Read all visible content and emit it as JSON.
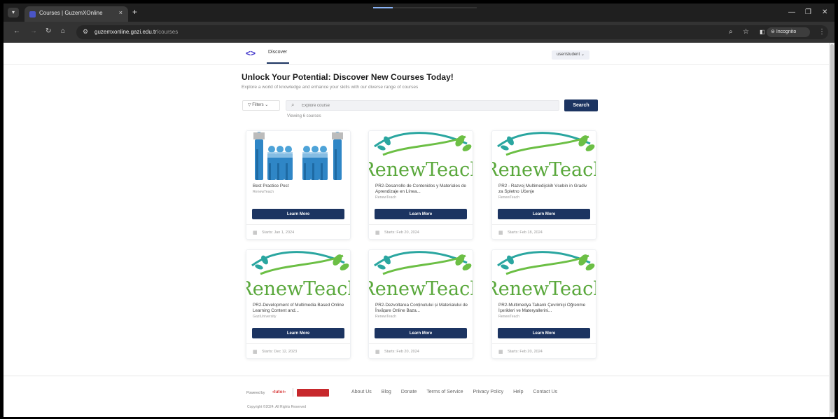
{
  "browser": {
    "tab_title": "Courses | GuzemXOnline",
    "close_tab": "×",
    "new_tab": "+",
    "url_host": "guzemxonline.gazi.edu.tr",
    "url_path": "/courses",
    "incognito_label": "Incognito"
  },
  "nav": {
    "discover": "Discover",
    "user_menu": "user/student ⌄"
  },
  "hero": {
    "title": "Unlock Your Potential: Discover New Courses Today!",
    "subtitle": "Explore a world of knowledge and enhance your skills with our diverse range of courses"
  },
  "search": {
    "filters_label": "Filters",
    "placeholder": "Explore course",
    "button": "Search",
    "viewing": "Viewing 6 courses"
  },
  "courses": [
    {
      "title": "Best Practice Post",
      "author": "RenewTeach",
      "button": "Learn More",
      "start": "Starts: Jan 1, 2024",
      "image": "people-icon"
    },
    {
      "title": "PR2-Desarrollo de Contenidos y Materiales de Aprendizaje en Línea...",
      "author": "RenewTeach",
      "button": "Learn More",
      "start": "Starts: Feb 20, 2024",
      "image": "renewteach-logo"
    },
    {
      "title": "PR2 - Razvoj Multimedijskih Vsebin in Gradiv za Spletno Učenje",
      "author": "RenewTeach",
      "button": "Learn More",
      "start": "Starts: Feb 18, 2024",
      "image": "renewteach-logo"
    },
    {
      "title": "PR2-Development of Multimedia Based Online Learning Content and...",
      "author": "GaziUniversity",
      "button": "Learn More",
      "start": "Starts: Dec 12, 2023",
      "image": "renewteach-logo"
    },
    {
      "title": "PR2-Dezvoltarea Conținutului și Materialului de Învățare Online Baza...",
      "author": "RenewTeach",
      "button": "Learn More",
      "start": "Starts: Feb 20, 2024",
      "image": "renewteach-logo"
    },
    {
      "title": "PR2-Multimedya Tabanlı Çevrimiçi Öğrenme İçerikleri ve Materyallerini...",
      "author": "RenewTeach",
      "button": "Learn More",
      "start": "Starts: Feb 20, 2024",
      "image": "renewteach-logo"
    }
  ],
  "logo_text": {
    "renew": "RenewTeach"
  },
  "footer": {
    "powered_by": "Powered by",
    "tutor": "tutor",
    "links": [
      "About Us",
      "Blog",
      "Donate",
      "Terms of Service",
      "Privacy Policy",
      "Help",
      "Contact Us"
    ],
    "copyright": "Copyright ©2024. All Rights Reserved"
  },
  "colors": {
    "primary": "#1c3461",
    "accent_logo": "#3b2fc9",
    "renew_green": "#5aa83c",
    "renew_teal": "#2aa6a0"
  }
}
